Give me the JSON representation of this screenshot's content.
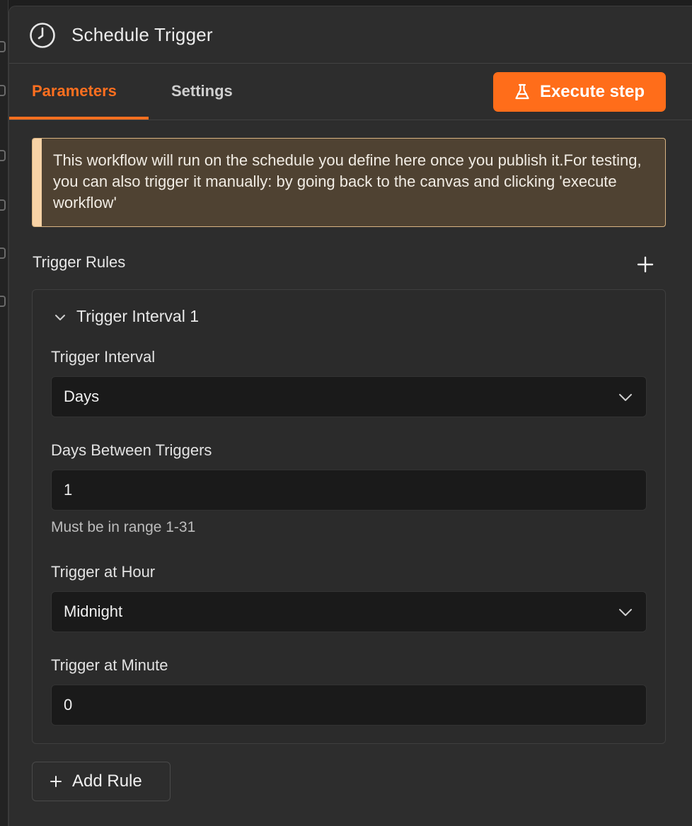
{
  "header": {
    "title": "Schedule Trigger",
    "icon": "clock-icon"
  },
  "tabs": [
    {
      "label": "Parameters",
      "active": true
    },
    {
      "label": "Settings",
      "active": false
    }
  ],
  "execute_button": {
    "label": "Execute step",
    "icon": "flask-icon"
  },
  "notice": {
    "text": "This workflow will run on the schedule you define here once you publish it.For testing, you can also trigger it manually: by going back to the canvas and clicking 'execute workflow'"
  },
  "trigger_rules": {
    "label": "Trigger Rules",
    "rule": {
      "title": "Trigger Interval 1",
      "fields": {
        "interval": {
          "label": "Trigger Interval",
          "value": "Days"
        },
        "days_between": {
          "label": "Days Between Triggers",
          "value": "1",
          "hint": "Must be in range 1-31"
        },
        "hour": {
          "label": "Trigger at Hour",
          "value": "Midnight"
        },
        "minute": {
          "label": "Trigger at Minute",
          "value": "0"
        }
      }
    },
    "add_rule_label": "Add Rule"
  },
  "colors": {
    "accent": "#ff6d1a",
    "panel_bg": "#2d2d2d",
    "notice_bg": "#4f4232",
    "notice_bar": "#f8d3a6",
    "input_bg": "#1a1a1a"
  }
}
